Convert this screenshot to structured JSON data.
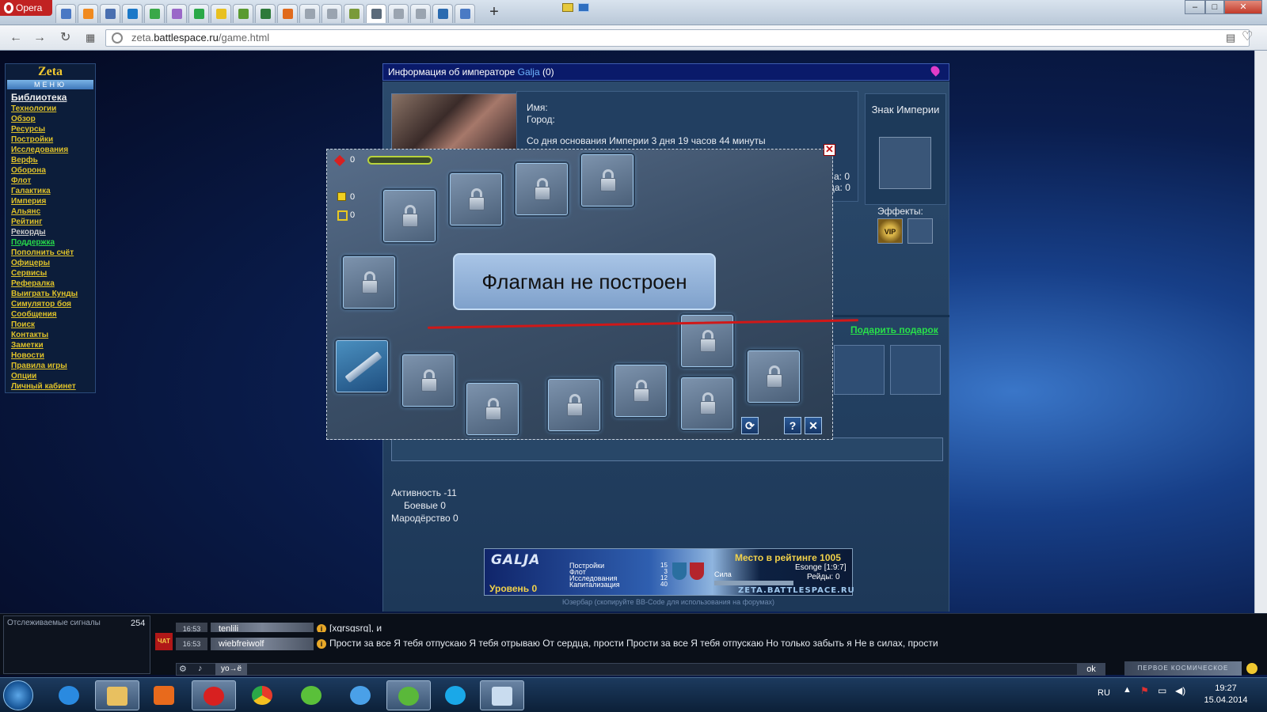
{
  "browser": {
    "app_label": "Opera",
    "url_prefix": "zeta.",
    "url_domain": "battlespace.ru",
    "url_path": "/game.html"
  },
  "menu": {
    "title": "Zeta",
    "subtitle": "МЕНЮ",
    "items": [
      {
        "label": "Библиотека",
        "style": "big"
      },
      {
        "label": "Технологии",
        "style": "normal"
      },
      {
        "label": "Обзор",
        "style": "normal"
      },
      {
        "label": "Ресурсы",
        "style": "normal"
      },
      {
        "label": "Постройки",
        "style": "normal"
      },
      {
        "label": "Исследования",
        "style": "normal"
      },
      {
        "label": "Верфь",
        "style": "normal"
      },
      {
        "label": "Оборона",
        "style": "normal"
      },
      {
        "label": "Флот",
        "style": "normal"
      },
      {
        "label": "Галактика",
        "style": "normal"
      },
      {
        "label": "Империя",
        "style": "normal"
      },
      {
        "label": "Альянс",
        "style": "normal"
      },
      {
        "label": "Рейтинг",
        "style": "normal"
      },
      {
        "label": "Рекорды",
        "style": "grey"
      },
      {
        "label": "Поддержка",
        "style": "green"
      },
      {
        "label": "Пополнить счёт",
        "style": "normal"
      },
      {
        "label": "Офицеры",
        "style": "normal"
      },
      {
        "label": "Сервисы",
        "style": "normal"
      },
      {
        "label": "Рефералка",
        "style": "normal"
      },
      {
        "label": "Выиграть Кунды",
        "style": "normal"
      },
      {
        "label": "Симулятор боя",
        "style": "normal"
      },
      {
        "label": "Сообщения",
        "style": "normal"
      },
      {
        "label": "Поиск",
        "style": "normal"
      },
      {
        "label": "Контакты",
        "style": "normal"
      },
      {
        "label": "Заметки",
        "style": "normal"
      },
      {
        "label": "Новости",
        "style": "normal"
      },
      {
        "label": "Правила игры",
        "style": "normal"
      },
      {
        "label": "Опции",
        "style": "normal"
      },
      {
        "label": "Личный кабинет",
        "style": "normal"
      }
    ]
  },
  "info": {
    "header_prefix": "Информация об императоре",
    "emperor_name": "Galja",
    "emperor_count": "(0)",
    "name_label": "Имя:",
    "city_label": "Город:",
    "founded_text": "Со дня основания Империи 3 дня 19 часов 44 минуты",
    "stat_a": "а: 0",
    "stat_b": "ца: 0",
    "emblem_title": "Знак Империи",
    "effects_label": "Эффекты:",
    "vip_label": "VIP",
    "gift_link": "Подарить подарок"
  },
  "stats": {
    "activity": "Активность -11",
    "combat": "Боевые 0",
    "marauding": "Мародёрство 0"
  },
  "userbar": {
    "name": "GALJA",
    "level": "Уровень 0",
    "rank": "Место в рейтинге 1005",
    "stat_labels": [
      "Постройки",
      "Флот",
      "Исследования",
      "Капитализация"
    ],
    "stat_values": [
      "15",
      "3",
      "12",
      "40"
    ],
    "sila": "Сила",
    "esonge": "Esonge [1:9:7]",
    "raids": "Рейды: 0",
    "site": "ZETA.BATTLESPACE.RU",
    "caption": "Юзербар (скопируйте BB-Code для использования на форумах)"
  },
  "modal": {
    "hp_value": "0",
    "res1_value": "0",
    "res2_value": "0",
    "message": "Флагман не построен",
    "close_label": "✕",
    "refresh_label": "⟳",
    "help_label": "?",
    "x_label": "✕"
  },
  "chat": {
    "signals_label": "Отслеживаемые сигналы",
    "signals_count": "254",
    "logo": "ЧАТ",
    "lines": [
      {
        "time": "16:53",
        "nick": "tenlili",
        "text": "[xgrsgsrg], и"
      },
      {
        "time": "16:53",
        "nick": "wiebfreiwolf",
        "text": "Прости за все Я тебя отпускаю Я тебя отрываю От сердца, прости Прости за все Я тебя отпускаю Но только забыть я Не в силах, прости"
      }
    ],
    "yo_label": "yo→ё",
    "ok_label": "ok",
    "banner": "ПЕРВОЕ КОСМИЧЕСКОЕ"
  },
  "taskbar": {
    "lang": "RU",
    "time": "19:27",
    "date": "15.04.2014"
  },
  "colors": {
    "menu_link": "#dfc22a",
    "green_link": "#27d84a",
    "header_bg": "#0a1a6a",
    "red_annotation": "#d01818"
  }
}
